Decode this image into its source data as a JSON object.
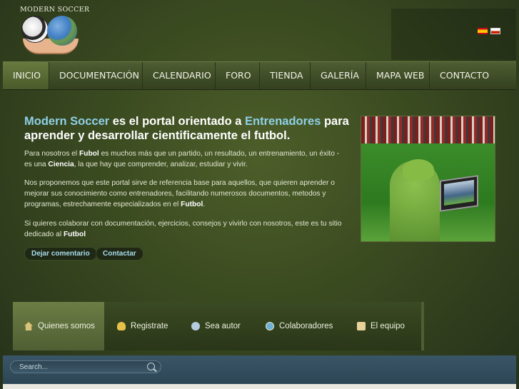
{
  "header": {
    "logo_text": "MODERN SOCCER",
    "languages": [
      "es",
      "ru"
    ]
  },
  "nav": {
    "items": [
      {
        "label": "INICIO",
        "active": true
      },
      {
        "label": "DOCUMENTACIÓN",
        "active": false
      },
      {
        "label": "CALENDARIO",
        "active": false
      },
      {
        "label": "FORO",
        "active": false
      },
      {
        "label": "TIENDA",
        "active": false
      },
      {
        "label": "GALERÍA",
        "active": false
      },
      {
        "label": "MAPA WEB",
        "active": false
      },
      {
        "label": "CONTACTO",
        "active": false
      }
    ]
  },
  "hero": {
    "title_part1": "Modern Soccer",
    "title_part2": " es el portal orientado a ",
    "title_part3": "Entrenadores",
    "title_part4": " para aprender y desarrollar cientificamente el futbol.",
    "p1_a": "Para nosotros el ",
    "p1_b": "Fubol",
    "p1_c": " es muchos más que un partido, un resultado,  un entrenamiento, un éxito - es una ",
    "p1_d": "Ciencia",
    "p1_e": ", la que hay que comprender, analizar, estudiar y vivir.",
    "p2_a": "Nos proponemos que este portal sirve de referencia base para aquellos, que quieren aprender o mejorar sus conocimiento como entrenadores, facilitando numerosos documentos, metodos y programas, estrechamente especializados en el ",
    "p2_b": "Futbol",
    "p2_c": ".",
    "p3_a": "Si quieres colaborar con documentación, ejercicios, consejos y vivirlo con nosotros, este es tu sitio dedicado al ",
    "p3_b": "Futbol",
    "btn_comment": "Dejar comentario",
    "btn_contact": "Contactar"
  },
  "tabs": [
    {
      "label": "Quienes somos",
      "icon": "home-icon",
      "color": "#d9c27a",
      "active": true
    },
    {
      "label": "Registrate",
      "icon": "badge-icon",
      "color": "#e6c24a",
      "active": false
    },
    {
      "label": "Sea autor",
      "icon": "chat-icon",
      "color": "#b7cbe0",
      "active": false
    },
    {
      "label": "Colaboradores",
      "icon": "globe-icon",
      "color": "#6fb0d8",
      "active": false
    },
    {
      "label": "El equipo",
      "icon": "document-icon",
      "color": "#e8d49a",
      "active": false
    }
  ],
  "search": {
    "placeholder": "Search..."
  },
  "colors": {
    "accent": "#8fd0e6",
    "nav_bg": "#4e5d32",
    "bottom_bar": "#34505f"
  }
}
